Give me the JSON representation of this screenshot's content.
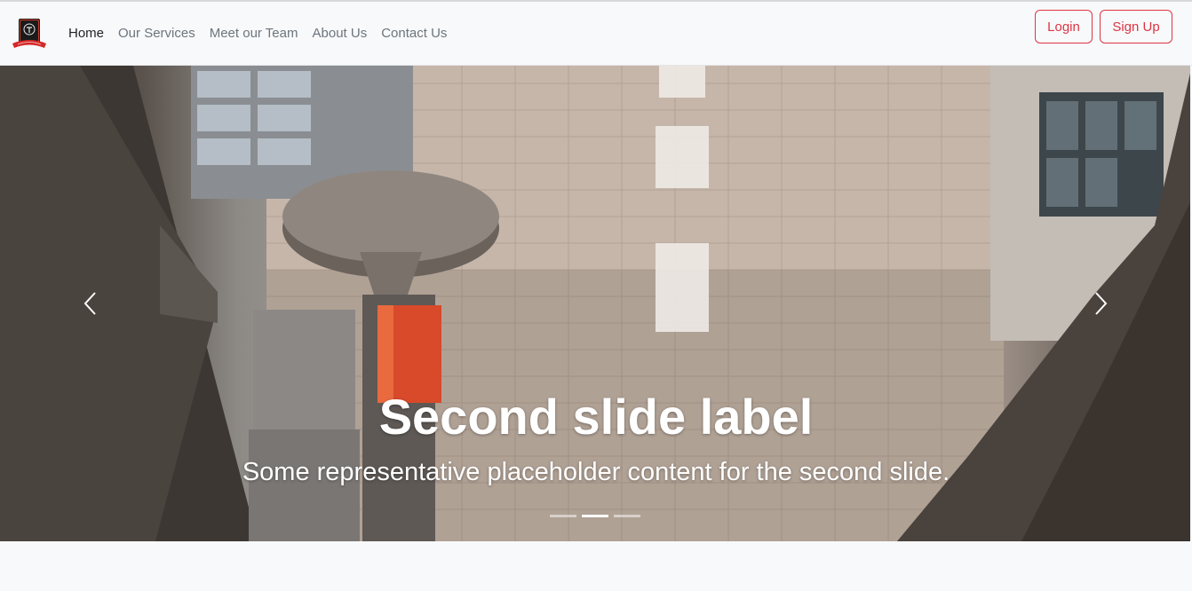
{
  "navbar": {
    "brand_logo": "shield-logo",
    "links": [
      {
        "label": "Home",
        "active": true
      },
      {
        "label": "Our Services",
        "active": false
      },
      {
        "label": "Meet our Team",
        "active": false
      },
      {
        "label": "About Us",
        "active": false
      },
      {
        "label": "Contact Us",
        "active": false
      }
    ],
    "login_label": "Login",
    "signup_label": "Sign Up"
  },
  "carousel": {
    "slide_title": "Second slide label",
    "slide_text": "Some representative placeholder content for the second slide.",
    "indicator_count": 3,
    "active_indicator": 2,
    "prev_icon": "chevron-left-icon",
    "next_icon": "chevron-right-icon"
  },
  "colors": {
    "accent": "#dc3545",
    "nav_bg": "#f8f9fa",
    "text_active": "#212529",
    "text_muted": "#6c757d"
  }
}
